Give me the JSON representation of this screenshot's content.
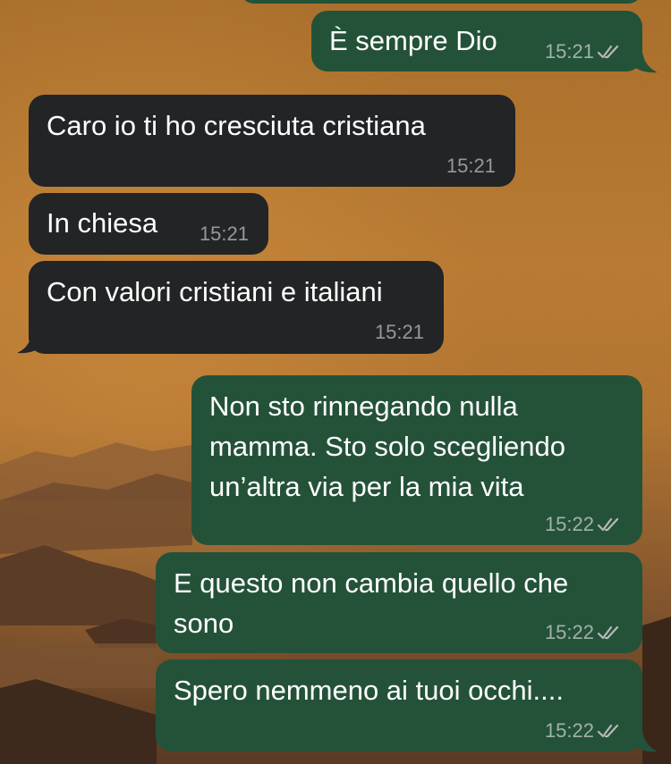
{
  "colors": {
    "incoming_bubble": "#222426",
    "outgoing_bubble": "#245239",
    "timestamp": "#9a9a9a",
    "background_sky": "#b8792f",
    "background_hills": "#3f2a1c"
  },
  "messages": [
    {
      "direction": "outgoing",
      "text": "È sempre Dio",
      "time": "15:21",
      "status_icon": "double-check-icon"
    },
    {
      "direction": "incoming",
      "text": "Caro io ti ho cresciuta cristiana",
      "time": "15:21"
    },
    {
      "direction": "incoming",
      "text": "In chiesa",
      "time": "15:21"
    },
    {
      "direction": "incoming",
      "text": "Con valori cristiani e italiani",
      "time": "15:21"
    },
    {
      "direction": "outgoing",
      "text": "Non sto rinnegando nulla\nmamma. Sto solo scegliendo\nun’altra via per la mia vita",
      "time": "15:22",
      "status_icon": "double-check-icon"
    },
    {
      "direction": "outgoing",
      "text": "E questo non cambia quello che\nsono",
      "time": "15:22",
      "status_icon": "double-check-icon"
    },
    {
      "direction": "outgoing",
      "text": "Spero nemmeno ai tuoi occhi....",
      "time": "15:22",
      "status_icon": "double-check-icon"
    }
  ]
}
